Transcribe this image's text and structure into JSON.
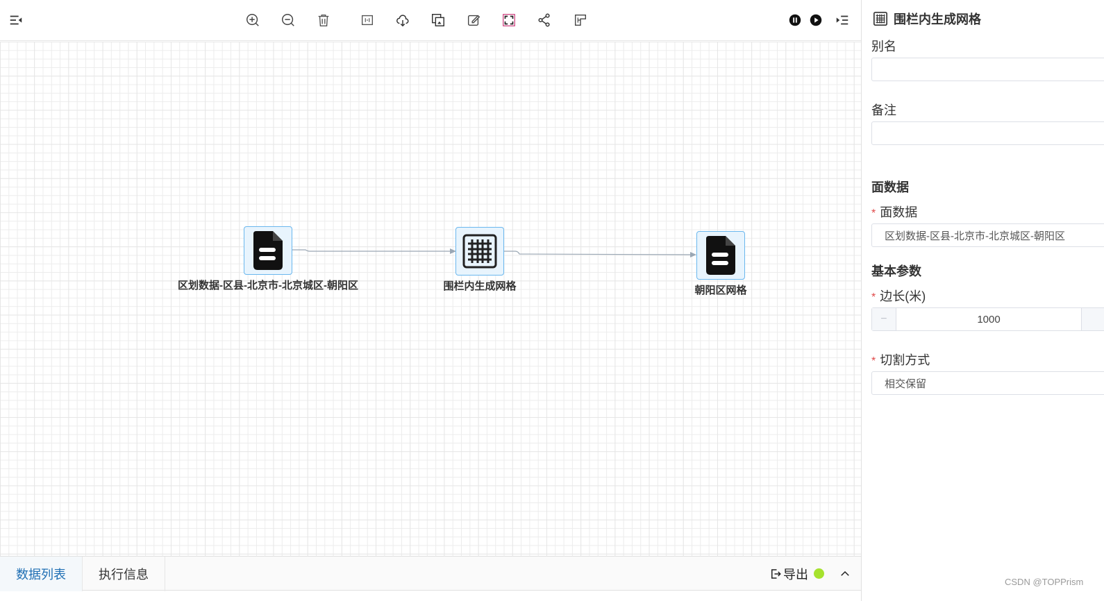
{
  "toolbar": {
    "left_icon": "collapse-menu-icon",
    "center_icons": [
      "zoom-in-icon",
      "zoom-out-icon",
      "delete-icon",
      "fit-icon",
      "cloud-download-icon",
      "layers-icon",
      "edit-icon",
      "fullscreen-icon",
      "share-icon",
      "layout-icon"
    ],
    "right_icons": [
      "pause-icon",
      "play-icon",
      "expand-menu-icon"
    ]
  },
  "flow": {
    "nodes": [
      {
        "label": "区划数据-区县-北京市-北京城区-朝阳区",
        "icon": "document-icon"
      },
      {
        "label": "围栏内生成网格",
        "icon": "grid-icon"
      },
      {
        "label": "朝阳区网格",
        "icon": "document-icon"
      }
    ]
  },
  "bottom": {
    "tabs": [
      "数据列表",
      "执行信息"
    ],
    "active_tab": "数据列表",
    "export_label": "导出",
    "status_color": "#a6e22e"
  },
  "panel": {
    "title": "围栏内生成网格",
    "alias_label": "别名",
    "alias_value": "",
    "remark_label": "备注",
    "remark_value": "",
    "section_surface": "面数据",
    "surface_label": "面数据",
    "surface_value": "区划数据-区县-北京市-北京城区-朝阳区",
    "section_basic": "基本参数",
    "side_label": "边长(米)",
    "side_value": "1000",
    "cut_label": "切割方式",
    "cut_value": "相交保留",
    "required_mark": "*"
  },
  "watermark": "CSDN @TOPPrism",
  "colors": {
    "accent": "#1f6fb4",
    "node_border": "#6ab7ee",
    "node_fill": "#e8f4fd",
    "required": "#e04a4a"
  }
}
